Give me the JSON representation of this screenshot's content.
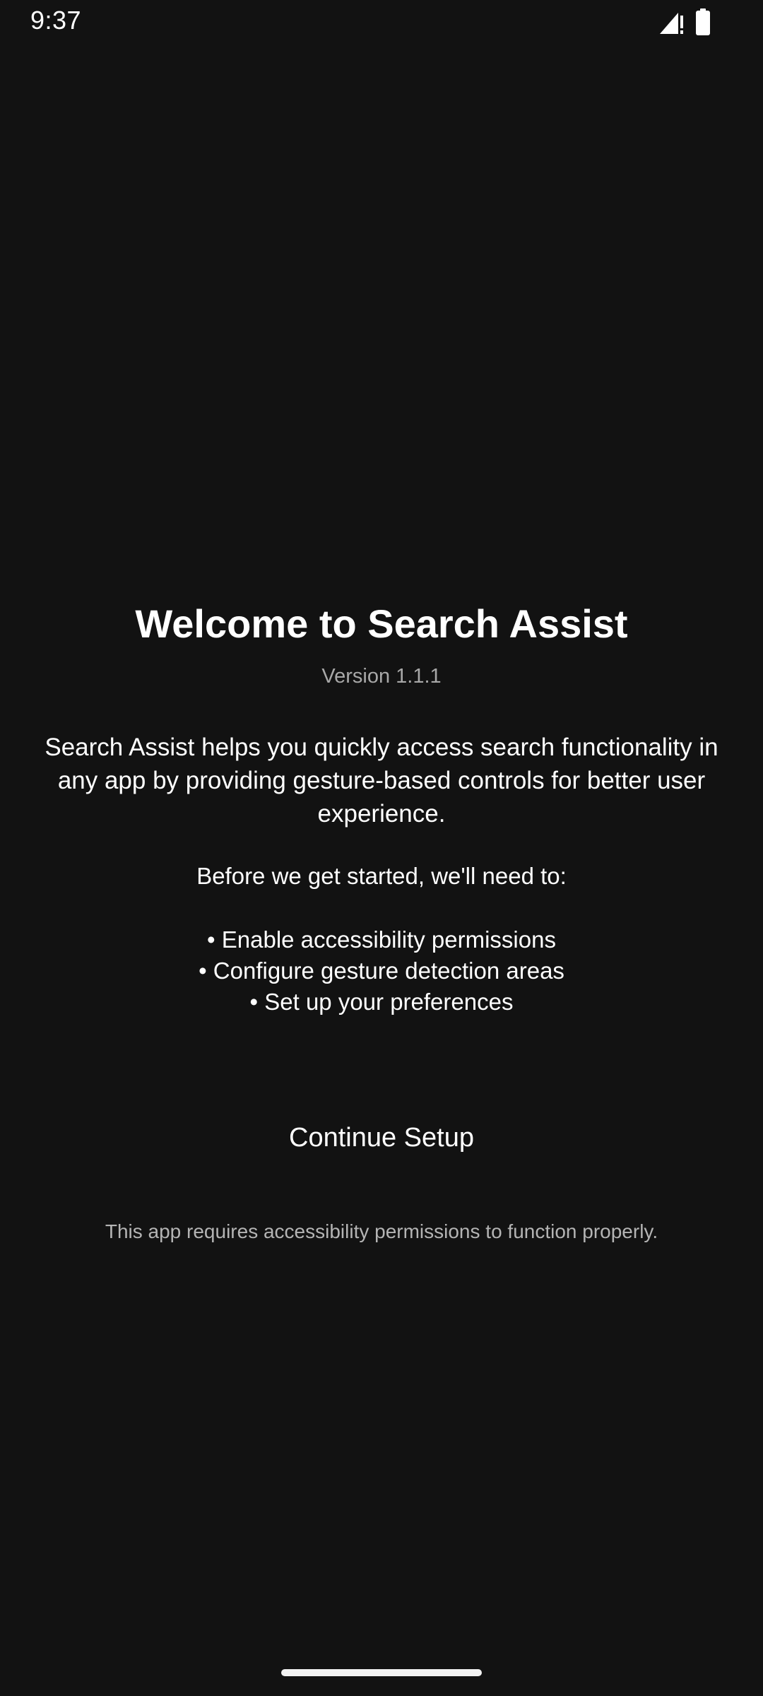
{
  "status_bar": {
    "time": "9:37",
    "icons": [
      "signal-icon",
      "battery-icon"
    ]
  },
  "welcome": {
    "title": "Welcome to Search Assist",
    "version": "Version 1.1.1",
    "description": "Search Assist helps you quickly access search functionality in any app by providing gesture-based controls for better user experience.",
    "before_text": "Before we get started, we'll need to:",
    "steps": [
      "• Enable accessibility permissions",
      "• Configure gesture detection areas",
      "• Set up your preferences"
    ],
    "continue_label": "Continue Setup",
    "footnote": "This app requires accessibility permissions to function properly."
  },
  "colors": {
    "background": "#121212",
    "text_primary": "#ffffff",
    "text_secondary": "#a8a8a8"
  }
}
